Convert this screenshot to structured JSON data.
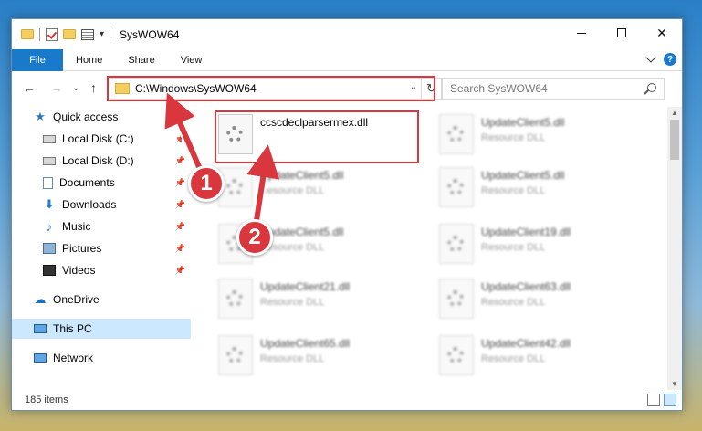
{
  "window": {
    "title": "SysWOW64"
  },
  "ribbon": {
    "tabs": [
      "File",
      "Home",
      "Share",
      "View"
    ],
    "help": "?"
  },
  "address": {
    "path": "C:\\Windows\\SysWOW64"
  },
  "search": {
    "placeholder": "Search SysWOW64"
  },
  "sidebar": {
    "items": [
      {
        "label": "Quick access",
        "icon": "star-icon"
      },
      {
        "label": "Local Disk (C:)",
        "icon": "disk-icon"
      },
      {
        "label": "Local Disk (D:)",
        "icon": "disk-icon"
      },
      {
        "label": "Documents",
        "icon": "document-icon"
      },
      {
        "label": "Downloads",
        "icon": "download-icon"
      },
      {
        "label": "Music",
        "icon": "music-icon"
      },
      {
        "label": "Pictures",
        "icon": "pictures-icon"
      },
      {
        "label": "Videos",
        "icon": "videos-icon"
      },
      {
        "label": "OneDrive",
        "icon": "cloud-icon"
      },
      {
        "label": "This PC",
        "icon": "computer-icon"
      },
      {
        "label": "Network",
        "icon": "network-icon"
      }
    ]
  },
  "files": [
    {
      "name": "ccscdeclparsermex.dll",
      "type": ""
    },
    {
      "name": "UpdateClient5.dll",
      "type": "Resource DLL"
    },
    {
      "name": "UpdateClient5.dll",
      "type": "Resource DLL"
    },
    {
      "name": "UpdateClient5.dll",
      "type": "Resource DLL"
    },
    {
      "name": "UpdateClient5.dll",
      "type": "Resource DLL"
    },
    {
      "name": "UpdateClient19.dll",
      "type": "Resource DLL"
    },
    {
      "name": "UpdateClient21.dll",
      "type": "Resource DLL"
    },
    {
      "name": "UpdateClient63.dll",
      "type": "Resource DLL"
    },
    {
      "name": "UpdateClient65.dll",
      "type": "Resource DLL"
    },
    {
      "name": "UpdateClient42.dll",
      "type": "Resource DLL"
    }
  ],
  "status": {
    "count": "185 items"
  },
  "callouts": [
    "1",
    "2"
  ],
  "colors": {
    "accent": "#1979ca",
    "highlight": "#d9363e",
    "selected": "#cce8ff"
  }
}
